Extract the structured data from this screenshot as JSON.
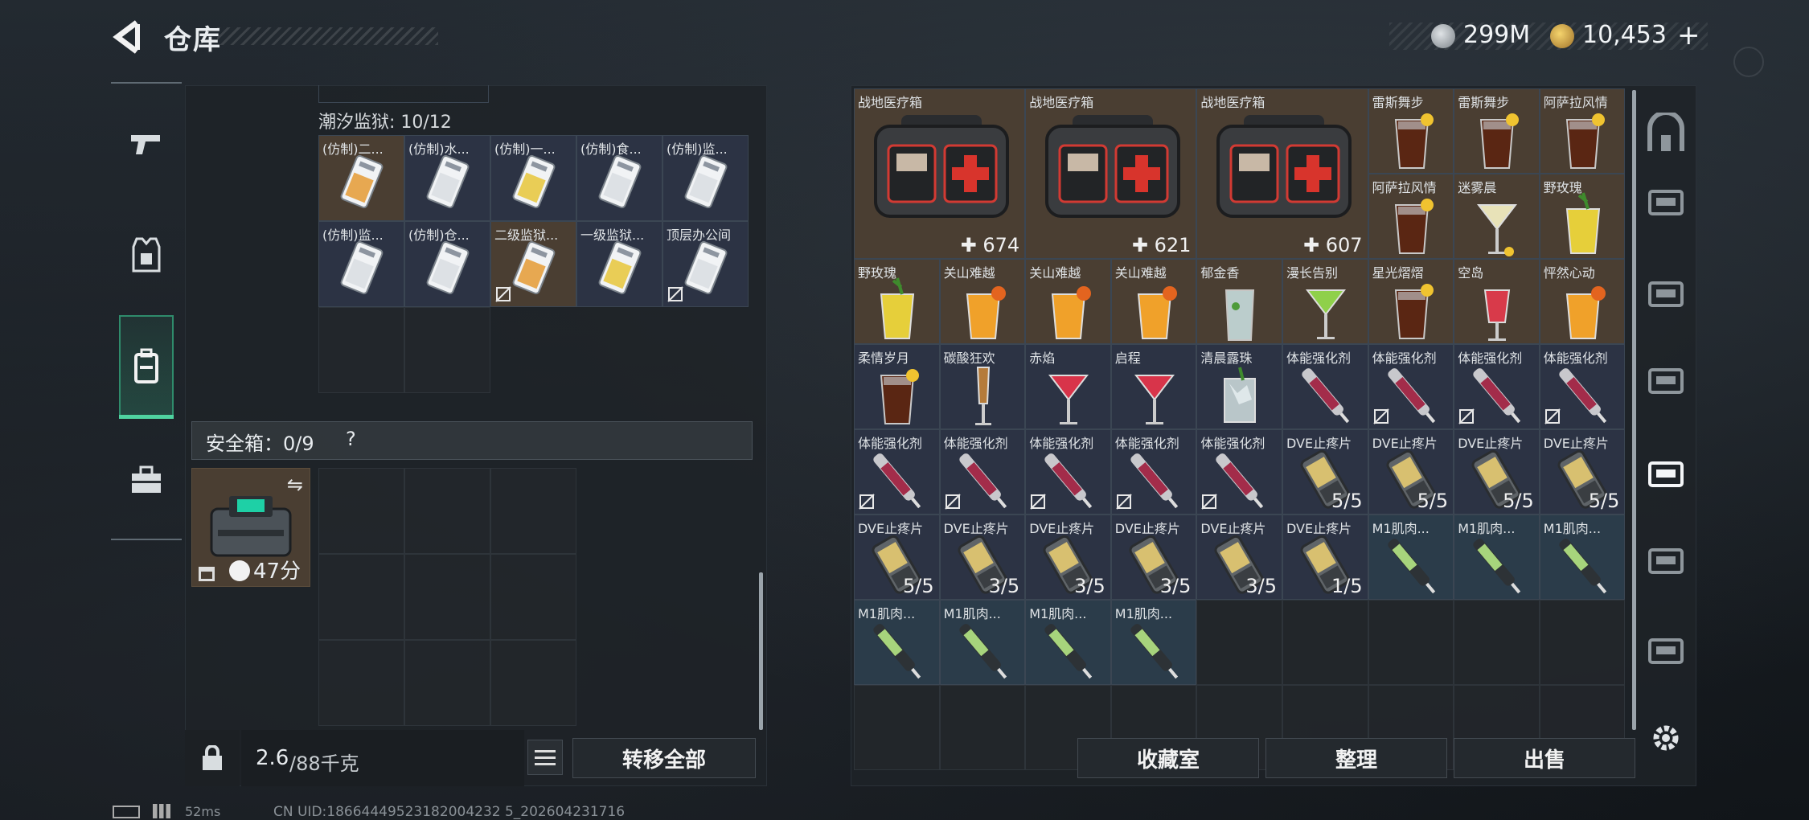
{
  "header": {
    "title": "仓库",
    "currency1": "299M",
    "currency2": "10,453",
    "currency2_plus": "+"
  },
  "left_nav": [
    {
      "name": "weapon",
      "icon": "pistol-icon"
    },
    {
      "name": "armor",
      "icon": "vest-icon"
    },
    {
      "name": "backpack",
      "icon": "backpack-icon",
      "active": true
    },
    {
      "name": "case",
      "icon": "briefcase-icon"
    }
  ],
  "container": {
    "name_label": "潮汐监狱: 10/12",
    "items": [
      {
        "label": "(仿制)二...",
        "color": "tan",
        "card": "orange"
      },
      {
        "label": "(仿制)水...",
        "color": "navy",
        "card": "white"
      },
      {
        "label": "(仿制)一...",
        "color": "navy",
        "card": "yellow"
      },
      {
        "label": "(仿制)食...",
        "color": "navy",
        "card": "white"
      },
      {
        "label": "(仿制)监...",
        "color": "navy",
        "card": "white"
      },
      {
        "label": "(仿制)监...",
        "color": "navy",
        "card": "white"
      },
      {
        "label": "(仿制)仓...",
        "color": "navy",
        "card": "white"
      },
      {
        "label": "二级监狱...",
        "color": "tan",
        "card": "orange",
        "nosell": true
      },
      {
        "label": "一级监狱...",
        "color": "navy",
        "card": "yellow"
      },
      {
        "label": "顶层办公间",
        "color": "navy",
        "card": "white",
        "nosell": true
      }
    ]
  },
  "safe_box": {
    "label": "安全箱：0/9",
    "help": "?",
    "timer": "47分"
  },
  "bottom_left": {
    "weight": "2.6",
    "weight_unit": "/88千克",
    "transfer_all": "转移全部"
  },
  "stash_items": [
    {
      "label": "战地医疗箱",
      "type": "medkit",
      "count": "674",
      "color": "tan"
    },
    {
      "label": "战地医疗箱",
      "type": "medkit",
      "count": "621",
      "color": "tan"
    },
    {
      "label": "战地医疗箱",
      "type": "medkit",
      "count": "607",
      "color": "tan"
    },
    {
      "label": "雷斯舞步",
      "type": "drink-cola",
      "color": "tan"
    },
    {
      "label": "雷斯舞步",
      "type": "drink-cola",
      "color": "tan"
    },
    {
      "label": "阿萨拉风情",
      "type": "drink-cola",
      "color": "tan"
    },
    {
      "label": "阿萨拉风情",
      "type": "drink-cola",
      "color": "tan"
    },
    {
      "label": "迷雾晨",
      "type": "drink-martini-y",
      "color": "tan"
    },
    {
      "label": "野玫瑰",
      "type": "drink-yellow",
      "color": "tan"
    },
    {
      "label": "野玫瑰",
      "type": "drink-yellow",
      "color": "tan"
    },
    {
      "label": "关山难越",
      "type": "drink-orange",
      "color": "tan"
    },
    {
      "label": "关山难越",
      "type": "drink-orange",
      "color": "tan"
    },
    {
      "label": "关山难越",
      "type": "drink-orange",
      "color": "tan"
    },
    {
      "label": "郁金香",
      "type": "drink-clear",
      "color": "tan"
    },
    {
      "label": "漫长告别",
      "type": "drink-martini-g",
      "color": "tan"
    },
    {
      "label": "星光熠熠",
      "type": "drink-cola",
      "color": "tan"
    },
    {
      "label": "空岛",
      "type": "drink-red",
      "color": "tan"
    },
    {
      "label": "怦然心动",
      "type": "drink-orange",
      "color": "tan"
    },
    {
      "label": "柔情岁月",
      "type": "drink-cola",
      "color": "navy"
    },
    {
      "label": "碳酸狂欢",
      "type": "drink-flute",
      "color": "navy"
    },
    {
      "label": "赤焰",
      "type": "drink-martini-r",
      "color": "navy"
    },
    {
      "label": "启程",
      "type": "drink-martini-r",
      "color": "navy"
    },
    {
      "label": "清晨露珠",
      "type": "drink-ice",
      "color": "navy"
    },
    {
      "label": "体能强化剂",
      "type": "syringe-red",
      "color": "navy"
    },
    {
      "label": "体能强化剂",
      "type": "syringe-red",
      "color": "navy",
      "nosell": true
    },
    {
      "label": "体能强化剂",
      "type": "syringe-red",
      "color": "navy",
      "nosell": true
    },
    {
      "label": "体能强化剂",
      "type": "syringe-red",
      "color": "navy",
      "nosell": true
    },
    {
      "label": "体能强化剂",
      "type": "syringe-red",
      "color": "navy",
      "nosell": true
    },
    {
      "label": "体能强化剂",
      "type": "syringe-red",
      "color": "navy",
      "nosell": true
    },
    {
      "label": "体能强化剂",
      "type": "syringe-red",
      "color": "navy",
      "nosell": true
    },
    {
      "label": "体能强化剂",
      "type": "syringe-red",
      "color": "navy",
      "nosell": true
    },
    {
      "label": "体能强化剂",
      "type": "syringe-red",
      "color": "navy",
      "nosell": true
    },
    {
      "label": "DVE止疼片",
      "type": "pillbox",
      "count": "5/5",
      "color": "navy"
    },
    {
      "label": "DVE止疼片",
      "type": "pillbox",
      "count": "5/5",
      "color": "navy"
    },
    {
      "label": "DVE止疼片",
      "type": "pillbox",
      "count": "5/5",
      "color": "navy"
    },
    {
      "label": "DVE止疼片",
      "type": "pillbox",
      "count": "5/5",
      "color": "navy"
    },
    {
      "label": "DVE止疼片",
      "type": "pillbox",
      "count": "5/5",
      "color": "navy"
    },
    {
      "label": "DVE止疼片",
      "type": "pillbox",
      "count": "3/5",
      "color": "navy"
    },
    {
      "label": "DVE止疼片",
      "type": "pillbox",
      "count": "3/5",
      "color": "navy"
    },
    {
      "label": "DVE止疼片",
      "type": "pillbox",
      "count": "3/5",
      "color": "navy"
    },
    {
      "label": "DVE止疼片",
      "type": "pillbox",
      "count": "3/5",
      "color": "navy"
    },
    {
      "label": "DVE止疼片",
      "type": "pillbox",
      "count": "1/5",
      "color": "navy"
    },
    {
      "label": "M1肌肉...",
      "type": "syringe-green",
      "color": "blue"
    },
    {
      "label": "M1肌肉...",
      "type": "syringe-green",
      "color": "blue"
    },
    {
      "label": "M1肌肉...",
      "type": "syringe-green",
      "color": "blue"
    },
    {
      "label": "M1肌肉...",
      "type": "syringe-green",
      "color": "blue"
    },
    {
      "label": "M1肌肉...",
      "type": "syringe-green",
      "color": "blue"
    },
    {
      "label": "M1肌肉...",
      "type": "syringe-green",
      "color": "blue"
    },
    {
      "label": "M1肌肉...",
      "type": "syringe-green",
      "color": "blue"
    }
  ],
  "bottom_right": {
    "collection": "收藏室",
    "sort": "整理",
    "sell": "出售"
  },
  "right_side_icons": [
    "room-icon",
    "iv-case-icon",
    "iv-folder-icon",
    "v-case-icon",
    "iv-add-icon",
    "iv-folder-icon",
    "iii-case-icon"
  ],
  "status": {
    "ping": "52ms",
    "uid": "CN UID:18664449523182004232 5_202604231716"
  },
  "colors": {
    "accent_green": "#4fd3a0",
    "tan": "#4a3e32",
    "navy": "#2c3344",
    "blue": "#2b3c4a"
  }
}
